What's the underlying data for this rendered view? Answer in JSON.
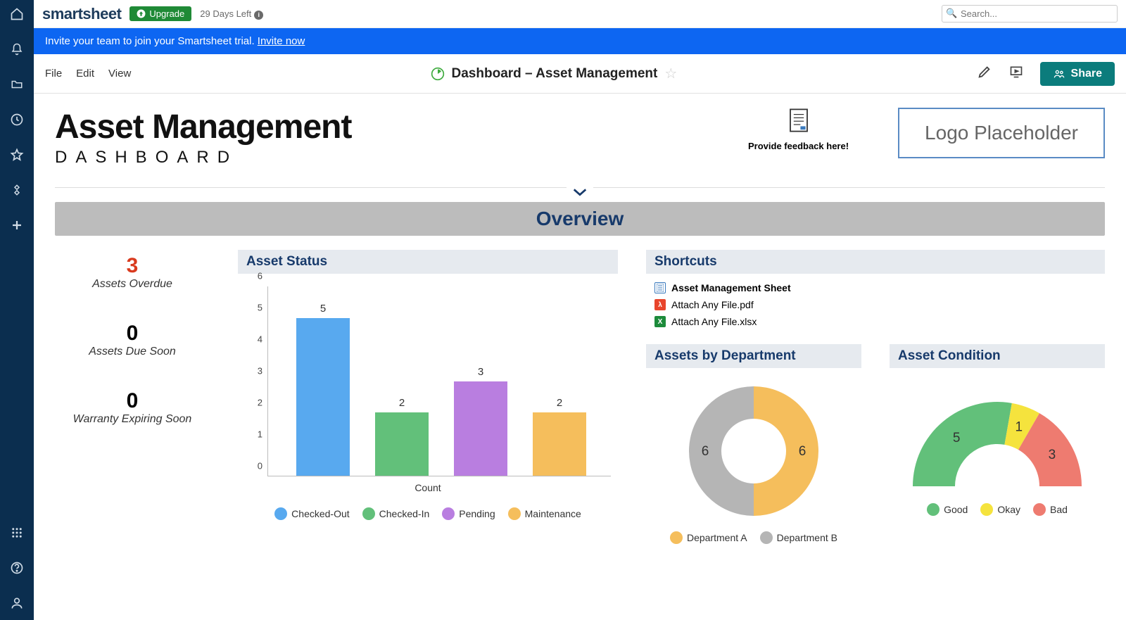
{
  "brand": "smartsheet",
  "upgrade": {
    "label": "Upgrade"
  },
  "trial": "29 Days Left",
  "search": {
    "placeholder": "Search..."
  },
  "banner": {
    "text": "Invite your team to join your Smartsheet trial. ",
    "link": "Invite now"
  },
  "menu": {
    "file": "File",
    "edit": "Edit",
    "view": "View"
  },
  "doc_title": "Dashboard – Asset Management",
  "share": "Share",
  "hero": {
    "title": "Asset Management",
    "subtitle": "DASHBOARD"
  },
  "feedback": "Provide feedback here!",
  "logo_placeholder": "Logo Placeholder",
  "overview": "Overview",
  "metrics": [
    {
      "value": "3",
      "label": "Assets Overdue",
      "red": true
    },
    {
      "value": "0",
      "label": "Assets Due Soon",
      "red": false
    },
    {
      "value": "0",
      "label": "Warranty Expiring Soon",
      "red": false
    }
  ],
  "asset_status_title": "Asset Status",
  "shortcuts_title": "Shortcuts",
  "shortcuts": [
    {
      "label": "Asset Management Sheet",
      "kind": "sheet",
      "bold": true
    },
    {
      "label": "Attach Any File.pdf",
      "kind": "pdf",
      "bold": false
    },
    {
      "label": "Attach Any File.xlsx",
      "kind": "xlsx",
      "bold": false
    }
  ],
  "dept_title": "Assets by Department",
  "cond_title": "Asset Condition",
  "chart_data": [
    {
      "type": "bar",
      "title": "Asset Status",
      "xlabel": "Count",
      "ylabel": "",
      "ylim": [
        0,
        6
      ],
      "categories": [
        "Checked-Out",
        "Checked-In",
        "Pending",
        "Maintenance"
      ],
      "values": [
        5,
        2,
        3,
        2
      ],
      "colors": [
        "#58a9ef",
        "#62c07a",
        "#b97ee0",
        "#f5be5c"
      ]
    },
    {
      "type": "pie",
      "title": "Assets by Department",
      "series": [
        {
          "name": "Department A",
          "value": 6,
          "color": "#f5be5c"
        },
        {
          "name": "Department B",
          "value": 6,
          "color": "#b5b5b5"
        }
      ]
    },
    {
      "type": "pie",
      "title": "Asset Condition",
      "subtype": "half-donut",
      "series": [
        {
          "name": "Good",
          "value": 5,
          "color": "#62c07a"
        },
        {
          "name": "Okay",
          "value": 1,
          "color": "#f5e33d"
        },
        {
          "name": "Bad",
          "value": 3,
          "color": "#ee7b70"
        }
      ]
    }
  ]
}
